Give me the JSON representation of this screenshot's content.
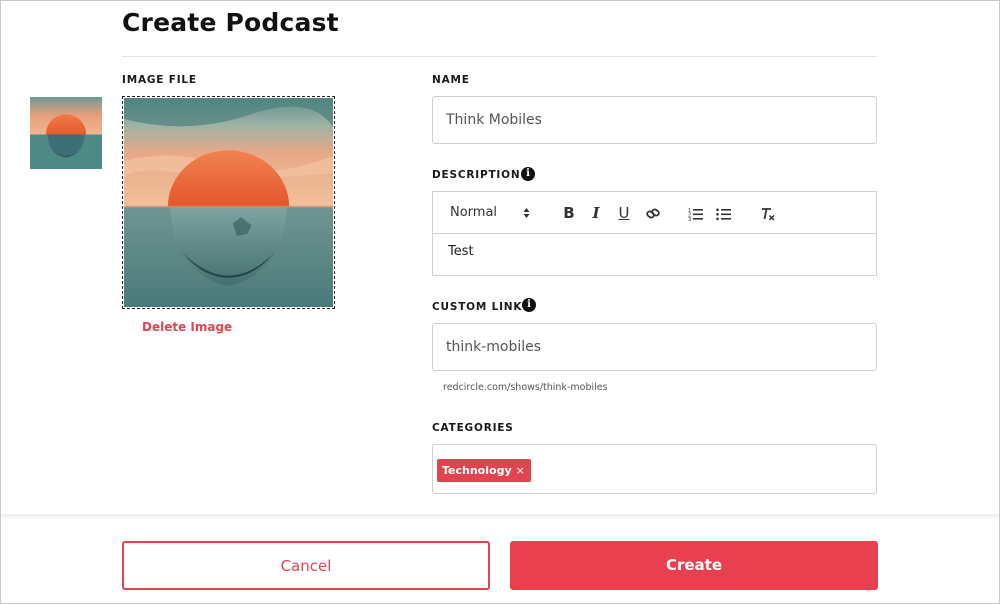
{
  "header": {
    "title": "Create Podcast"
  },
  "image_section": {
    "label": "IMAGE FILE",
    "delete_label": "Delete Image"
  },
  "name": {
    "label": "NAME",
    "value": "Think Mobiles"
  },
  "description": {
    "label": "DESCRIPTION",
    "info_icon": "info-icon",
    "toolbar": {
      "format": "Normal",
      "format_arrows": "▲▼",
      "bold": "B",
      "italic": "I",
      "underline": "U",
      "link_icon": "link-icon",
      "ordered_list_icon": "ordered-list-icon",
      "bullet_list_icon": "bullet-list-icon",
      "clear_format_icon": "clear-format-icon"
    },
    "body": "Test"
  },
  "custom_link": {
    "label": "CUSTOM LINK",
    "info_icon": "info-icon",
    "value": "think-mobiles",
    "helper": "redcircle.com/shows/think-mobiles"
  },
  "categories": {
    "label": "CATEGORIES",
    "tags": [
      {
        "label": "Technology",
        "remove": "×"
      }
    ]
  },
  "footer": {
    "cancel_label": "Cancel",
    "create_label": "Create"
  },
  "colors": {
    "accent": "#e8404e",
    "border": "#cfcfcf",
    "text": "#1a1a1a"
  }
}
